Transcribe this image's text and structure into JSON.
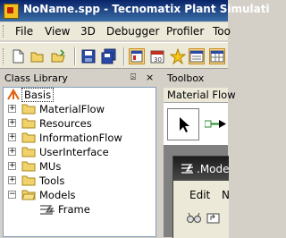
{
  "window": {
    "title": "NoName.spp - Tecnomatix Plant Simulati"
  },
  "menubar": {
    "items": [
      "File",
      "View",
      "3D",
      "Debugger",
      "Profiler",
      "Too"
    ]
  },
  "toolbar": {
    "buttons": [
      "new-file-icon",
      "open-folder-icon",
      "open-icon",
      "save-icon",
      "save-all-icon",
      "class-library-toggle-icon",
      "calendar-icon",
      "favorites-star-icon",
      "console-toggle-icon",
      "grid-icon"
    ]
  },
  "class_library": {
    "title": "Class Library",
    "pin_glyph": "⍄",
    "close_glyph": "×",
    "tree": [
      {
        "label": "Basis",
        "level": 0
      },
      {
        "label": "MaterialFlow",
        "level": 1,
        "expander": "+"
      },
      {
        "label": "Resources",
        "level": 1,
        "expander": "+"
      },
      {
        "label": "InformationFlow",
        "level": 1,
        "expander": "+"
      },
      {
        "label": "UserInterface",
        "level": 1,
        "expander": "+"
      },
      {
        "label": "MUs",
        "level": 1,
        "expander": "+"
      },
      {
        "label": "Tools",
        "level": 1,
        "expander": "+"
      },
      {
        "label": "Models",
        "level": 1,
        "expander": "−"
      },
      {
        "label": "Frame",
        "level": 2
      }
    ]
  },
  "toolbox": {
    "title": "Toolbox",
    "active_tab": "Material Flow"
  },
  "model_window": {
    "title": ".Mode",
    "menu": [
      "Edit",
      "N"
    ]
  }
}
